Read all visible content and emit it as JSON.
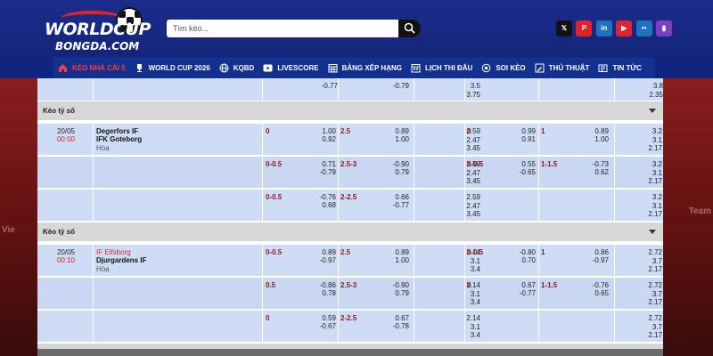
{
  "header": {
    "logo_top": "WORLDCUP",
    "logo_bottom": "BONGDA.COM",
    "search_placeholder": "Tìm kèo...",
    "socials": [
      {
        "icon": "x-icon",
        "glyph": "𝕏",
        "color": "#111111"
      },
      {
        "icon": "pinterest-icon",
        "glyph": "P",
        "color": "#e0232a"
      },
      {
        "icon": "linkedin-icon",
        "glyph": "in",
        "color": "#1e73be"
      },
      {
        "icon": "youtube-icon",
        "glyph": "▶",
        "color": "#e0232a"
      },
      {
        "icon": "flickr-icon",
        "glyph": "••",
        "color": "#1e73be"
      },
      {
        "icon": "twitch-icon",
        "glyph": "▮",
        "color": "#7b3fc4"
      }
    ]
  },
  "nav": [
    {
      "label": "KÈO NHÀ CÁI 5",
      "icon": "home-icon",
      "active": true
    },
    {
      "label": "WORLD CUP 2026",
      "icon": "trophy-icon"
    },
    {
      "label": "KQBD",
      "icon": "globe-icon"
    },
    {
      "label": "LIVESCORE",
      "icon": "play-icon"
    },
    {
      "label": "BẢNG XẾP HẠNG",
      "icon": "calendar-grid-icon"
    },
    {
      "label": "LỊCH THI ĐẤU",
      "icon": "calendar-icon"
    },
    {
      "label": "SOI KÈO",
      "icon": "target-icon"
    },
    {
      "label": "THỦ THUẬT",
      "icon": "pencil-icon"
    },
    {
      "label": "TIN TỨC",
      "icon": "news-icon"
    }
  ],
  "section_label": "Kèo tỷ số",
  "top_partial": {
    "c1": "-0.77",
    "c2": "-0.79",
    "x1": "3.5",
    "x2": "3.75",
    "r1": "3.8",
    "r2": "2.35"
  },
  "matches": [
    {
      "date": "20/05",
      "time": "00:00",
      "home": "Degerfors IF",
      "away": "IFK Goteborg",
      "home_highlight": false,
      "draw": "Hòa",
      "rows": [
        {
          "h1": "0",
          "h1a": "1.00",
          "h1b": "0.92",
          "h2": "2.5",
          "h2a": "0.89",
          "h2b": "1.00",
          "x": [
            "2.59",
            "2.47",
            "3.45"
          ],
          "h3": "0",
          "h3a": "0.99",
          "h3b": "0.91",
          "h4": "1",
          "h4a": "0.89",
          "h4b": "1.00",
          "r": [
            "3.2",
            "3.1",
            "2.17"
          ]
        },
        {
          "h1": "0-0.5",
          "h1a": "0.71",
          "h1b": "-0.79",
          "h2": "2.5-3",
          "h2a": "-0.90",
          "h2b": "0.79",
          "x": [
            "2.59",
            "2.47",
            "3.45"
          ],
          "h3": "0-0.5",
          "h3a": "0.55",
          "h3b": "-0.65",
          "h4": "1-1.5",
          "h4a": "-0.73",
          "h4b": "0.62",
          "r": [
            "3.2",
            "3.1",
            "2.17"
          ]
        },
        {
          "h1": "0-0.5",
          "h1a": "-0.76",
          "h1b": "0.68",
          "h2": "2-2.5",
          "h2a": "0.66",
          "h2b": "-0.77",
          "x": [
            "2.59",
            "2.47",
            "3.45"
          ],
          "h3": "",
          "h3a": "",
          "h3b": "",
          "h4": "",
          "h4a": "",
          "h4b": "",
          "r": [
            "3.2",
            "3.1",
            "2.17"
          ]
        }
      ]
    },
    {
      "date": "20/05",
      "time": "00:10",
      "home": "IF Elfsborg",
      "away": "Djurgardens IF",
      "home_highlight": true,
      "draw": "Hòa",
      "rows": [
        {
          "h1": "0-0.5",
          "h1a": "0.89",
          "h1b": "-0.97",
          "h2": "2.5",
          "h2a": "0.89",
          "h2b": "1.00",
          "x": [
            "2.14",
            "3.1",
            "3.4"
          ],
          "h3": "0-0.5",
          "h3a": "-0.80",
          "h3b": "0.70",
          "h4": "1",
          "h4a": "0.86",
          "h4b": "-0.97",
          "r": [
            "2.72",
            "3.7",
            "2.17"
          ]
        },
        {
          "h1": "0.5",
          "h1a": "-0.86",
          "h1b": "0.78",
          "h2": "2.5-3",
          "h2a": "-0.90",
          "h2b": "0.79",
          "x": [
            "2.14",
            "3.1",
            "3.4"
          ],
          "h3": "0",
          "h3a": "0.67",
          "h3b": "-0.77",
          "h4": "1-1.5",
          "h4a": "-0.76",
          "h4b": "0.65",
          "r": [
            "2.72",
            "3.7",
            "2.17"
          ]
        },
        {
          "h1": "0",
          "h1a": "0.59",
          "h1b": "-0.67",
          "h2": "2-2.5",
          "h2a": "0.67",
          "h2b": "-0.78",
          "x": [
            "2.14",
            "3.1",
            "3.4"
          ],
          "h3": "",
          "h3a": "",
          "h3b": "",
          "h4": "",
          "h4a": "",
          "h4b": "",
          "r": [
            "2.72",
            "3.7",
            "2.17"
          ]
        }
      ]
    }
  ]
}
